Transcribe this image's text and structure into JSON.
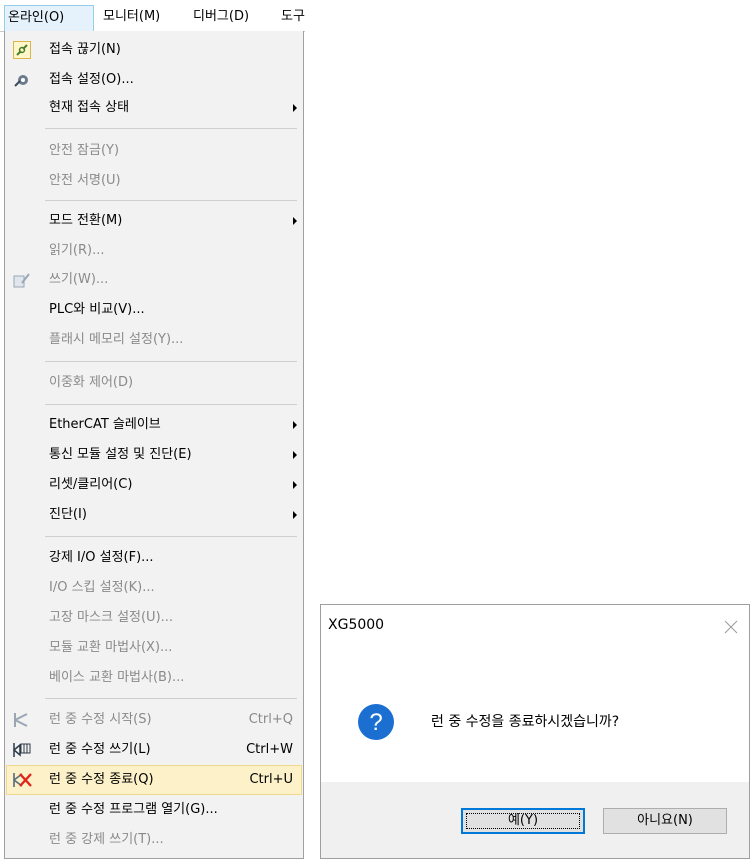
{
  "menubar": {
    "items": [
      {
        "label": "온라인(O)",
        "active": true
      },
      {
        "label": "모니터(M)"
      },
      {
        "label": "디버그(D)"
      },
      {
        "label": "도구"
      }
    ]
  },
  "menu": {
    "items": [
      {
        "label": "접속 끊기(N)",
        "icon": "disconnect-icon",
        "disabled": false
      },
      {
        "label": "접속 설정(O)...",
        "icon": "connection-settings-icon",
        "disabled": false
      },
      {
        "label": "현재 접속 상태",
        "submenu": true,
        "disabled": false
      },
      {
        "label": "안전 잠금(Y)",
        "disabled": true
      },
      {
        "label": "안전 서명(U)",
        "disabled": true
      },
      {
        "label": "모드 전환(M)",
        "submenu": true,
        "disabled": false
      },
      {
        "label": "읽기(R)...",
        "disabled": true
      },
      {
        "label": "쓰기(W)...",
        "icon": "write-icon",
        "disabled": true
      },
      {
        "label": "PLC와 비교(V)...",
        "disabled": false
      },
      {
        "label": "플래시 메모리 설정(Y)...",
        "disabled": true
      },
      {
        "label": "이중화 제어(D)",
        "disabled": true
      },
      {
        "label": "EtherCAT 슬레이브",
        "submenu": true,
        "disabled": false
      },
      {
        "label": "통신 모듈 설정 및 진단(E)",
        "submenu": true,
        "disabled": false
      },
      {
        "label": "리셋/클리어(C)",
        "submenu": true,
        "disabled": false
      },
      {
        "label": "진단(I)",
        "submenu": true,
        "disabled": false
      },
      {
        "label": "강제 I/O 설정(F)...",
        "disabled": false
      },
      {
        "label": "I/O 스킵 설정(K)...",
        "disabled": true
      },
      {
        "label": "고장 마스크 설정(U)...",
        "disabled": true
      },
      {
        "label": "모듈 교환 마법사(X)...",
        "disabled": true
      },
      {
        "label": "베이스 교환 마법사(B)...",
        "disabled": true
      },
      {
        "label": "런 중 수정 시작(S)",
        "shortcut": "Ctrl+Q",
        "icon": "run-edit-start-icon",
        "disabled": true
      },
      {
        "label": "런 중 수정 쓰기(L)",
        "shortcut": "Ctrl+W",
        "icon": "run-edit-write-icon",
        "disabled": false
      },
      {
        "label": "런 중 수정 종료(Q)",
        "shortcut": "Ctrl+U",
        "icon": "run-edit-end-icon",
        "disabled": false,
        "highlighted": true
      },
      {
        "label": "런 중 수정 프로그램 열기(G)...",
        "disabled": false
      },
      {
        "label": "런 중 강제 쓰기(T)...",
        "disabled": true
      }
    ]
  },
  "dialog": {
    "title": "XG5000",
    "message": "런 중 수정을 종료하시겠습니까?",
    "icon": "question-icon",
    "yes_label": "예(Y)",
    "no_label": "아니요(N)",
    "accent_color": "#0078d7"
  },
  "colors": {
    "highlight": "#fcf1c8",
    "menu_bg": "#f2f2f2",
    "disabled_text": "#8a8a8a",
    "question_icon": "#1a6fd0"
  }
}
